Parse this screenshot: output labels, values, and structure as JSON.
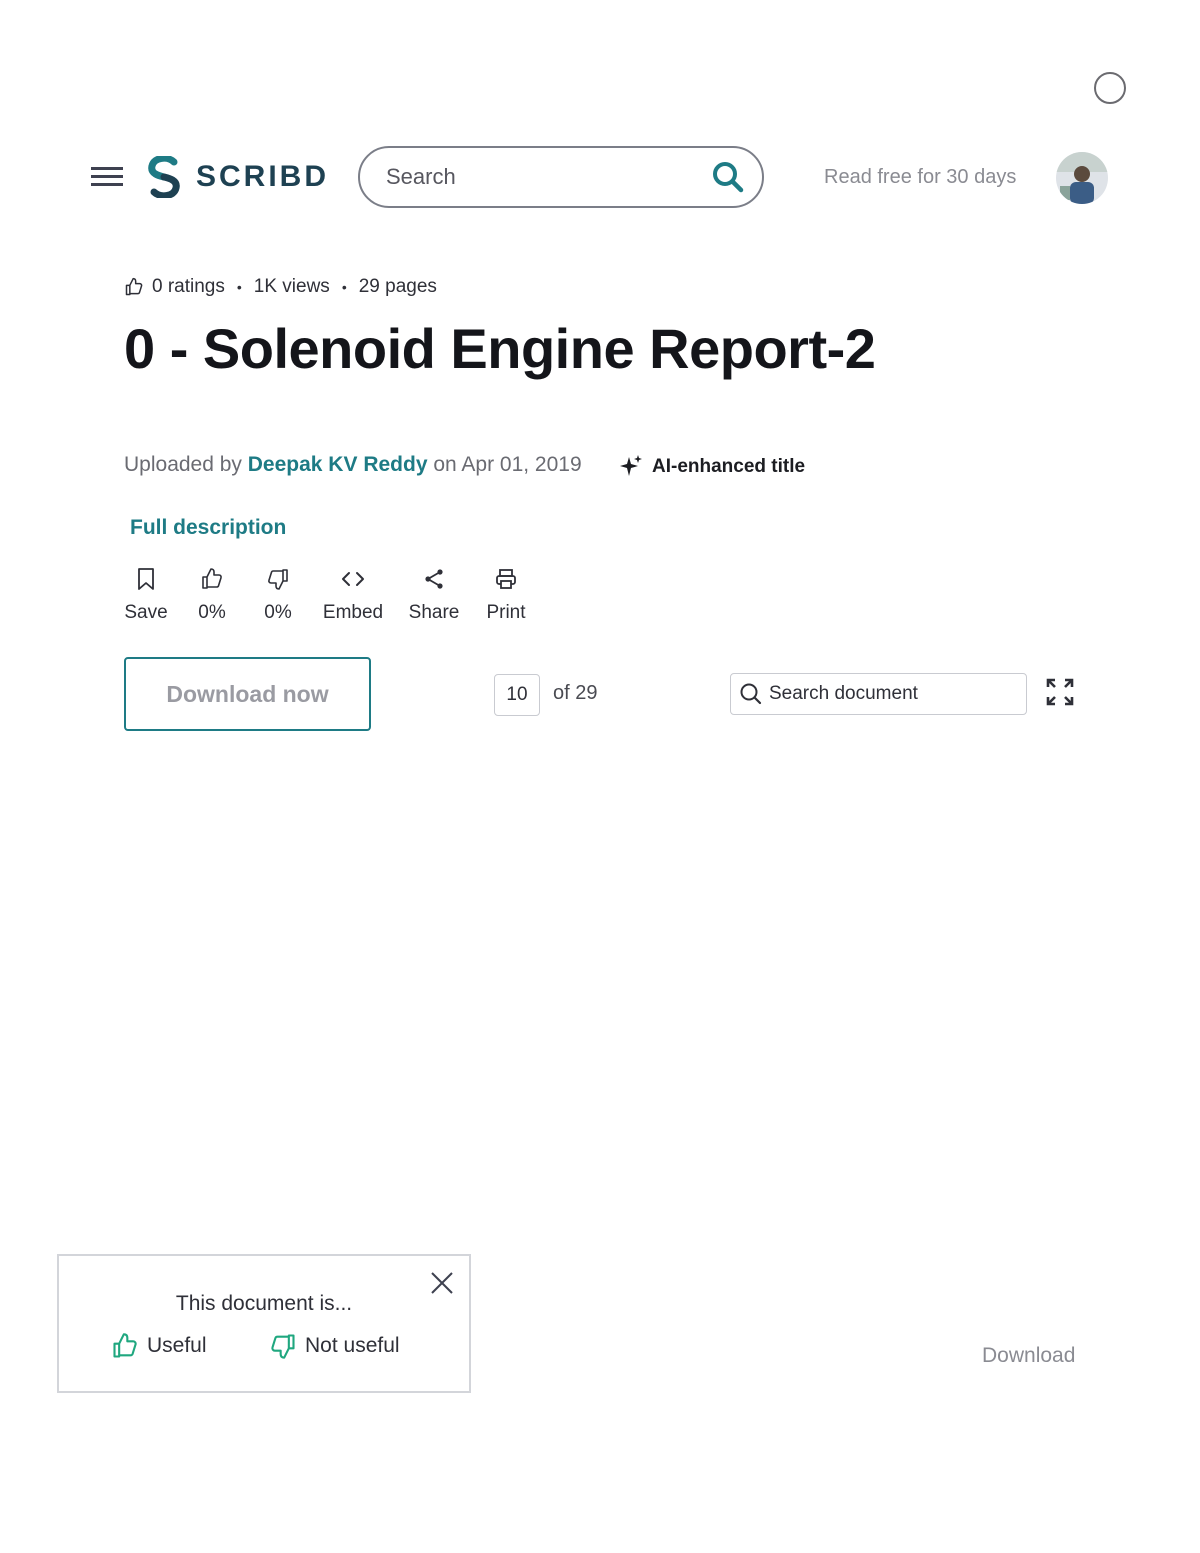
{
  "header": {
    "logo_text": "SCRIBD",
    "search_placeholder": "Search",
    "read_free": "Read free for 30 days"
  },
  "meta": {
    "ratings": "0 ratings",
    "views": "1K views",
    "pages": "29 pages"
  },
  "document": {
    "title": "0 - Solenoid Engine Report-2",
    "uploaded_prefix": "Uploaded by",
    "author": "Deepak KV Reddy",
    "uploaded_suffix": "on Apr 01, 2019",
    "ai_label": "AI-enhanced title",
    "full_description": "Full description"
  },
  "actions": {
    "save": "Save",
    "like": "0%",
    "dislike": "0%",
    "embed": "Embed",
    "share": "Share",
    "print": "Print"
  },
  "toolbar": {
    "download_now": "Download now",
    "current_page": "10",
    "of_pages": "of 29",
    "search_placeholder": "Search document"
  },
  "feedback": {
    "title": "This document is...",
    "useful": "Useful",
    "not_useful": "Not useful"
  },
  "footer": {
    "download": "Download"
  },
  "colors": {
    "brand": "#1e7b85",
    "logo": "#1e4152",
    "useful_green": "#1fa77f"
  }
}
